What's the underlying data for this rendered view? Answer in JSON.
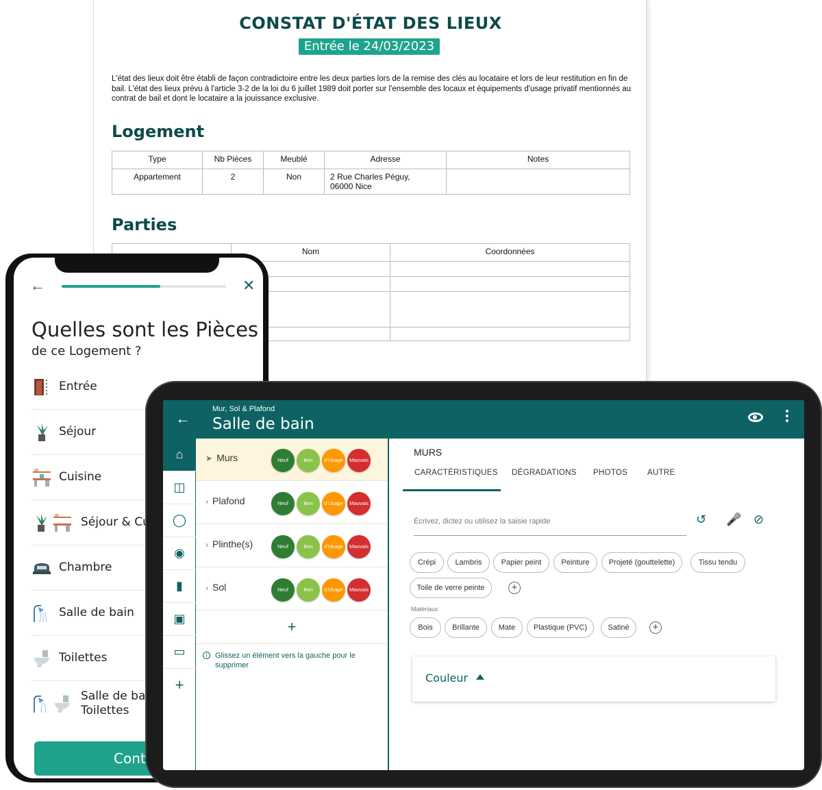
{
  "document": {
    "title": "CONSTAT D'ÉTAT DES LIEUX",
    "date_badge": "Entrée le 24/03/2023",
    "intro": "L'état des lieux doit être établi de façon contradictoire entre les deux parties lors de la remise des clés au locataire et lors de leur restitution en fin de bail. L'état des lieux prévu à l'article 3-2 de la loi du 6 juillet 1989 doit porter sur l'ensemble des locaux et équipements d'usage privatif mentionnés au contrat de bail et dont le locataire a la jouissance exclusive.",
    "logement_heading": "Logement",
    "logement_table": {
      "headers": [
        "Type",
        "Nb Pièces",
        "Meublé",
        "Adresse",
        "Notes"
      ],
      "row": [
        "Appartement",
        "2",
        "Non",
        "2 Rue Charles Péguy,\n06000 Nice",
        ""
      ]
    },
    "parties_heading": "Parties",
    "parties_table": {
      "headers": [
        "",
        "Nom",
        "Coordonnées"
      ]
    }
  },
  "phone": {
    "progress": 0.6,
    "question": "Quelles sont les Pièces",
    "question_sub": "de ce Logement ?",
    "rooms": [
      {
        "label": "Entrée",
        "icon": "door-icon"
      },
      {
        "label": "Séjour",
        "icon": "plant-icon"
      },
      {
        "label": "Cuisine",
        "icon": "kitchen-icon"
      },
      {
        "label": "Séjour & Cuis",
        "icon": "living-kitchen-icon"
      },
      {
        "label": "Chambre",
        "icon": "bed-icon"
      },
      {
        "label": "Salle de bain",
        "icon": "shower-icon"
      },
      {
        "label": "Toilettes",
        "icon": "toilet-icon"
      },
      {
        "label": "Salle de bain\nToilettes",
        "icon": "bath-toilet-icon"
      }
    ],
    "cta": "Contir"
  },
  "tablet": {
    "subtitle": "Mur, Sol & Plafond",
    "title": "Salle de bain",
    "rail_icons": [
      "home-icon",
      "columns-icon",
      "bulb-icon",
      "drop-icon",
      "thermometer-icon",
      "window-icon",
      "inbox-icon",
      "plus-icon"
    ],
    "items": [
      {
        "name": "Murs",
        "selected": true
      },
      {
        "name": "Plafond",
        "selected": false
      },
      {
        "name": "Plinthe(s)",
        "selected": false
      },
      {
        "name": "Sol",
        "selected": false
      }
    ],
    "states": [
      {
        "label": "Neuf",
        "color": "#2e7d32"
      },
      {
        "label": "Bon",
        "color": "#8bc34a"
      },
      {
        "label": "d'Usage",
        "color": "#ff9800"
      },
      {
        "label": "Mauvais",
        "color": "#d32f2f"
      }
    ],
    "add_label": "+",
    "hint": "Glissez un élément vers la gauche pour le supprimer",
    "detail": {
      "section": "MURS",
      "tabs": [
        "CARACTÉRISTIQUES",
        "DÉGRADATIONS",
        "PHOTOS",
        "AUTRE"
      ],
      "input_placeholder": "Écrivez, dictez ou utilisez la saisie rapide",
      "chips": [
        "Crépi",
        "Lambris",
        "Papier peint",
        "Peinture",
        "Projeté (gouttelette)",
        "Tissu tendu",
        "Toile de verre peinte"
      ],
      "materials_label": "Matériaux",
      "materials": [
        "Bois",
        "Brillante",
        "Mate",
        "Plastique (PVC)",
        "Satiné"
      ],
      "couleur": "Couleur"
    },
    "colors": {
      "primary": "#0e6263",
      "accent": "#1fa38c"
    }
  }
}
